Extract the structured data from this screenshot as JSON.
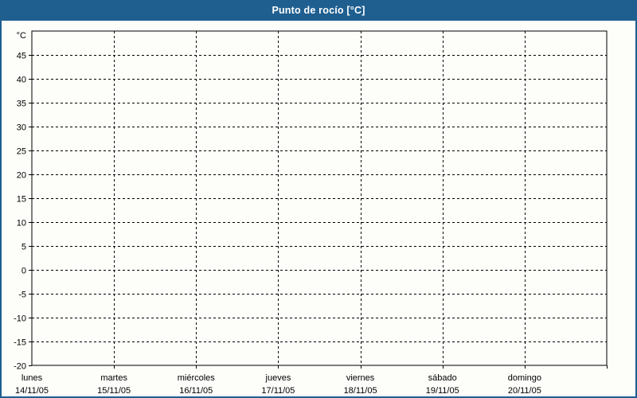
{
  "window": {
    "title": "Punto de rocío [°C]"
  },
  "colors": {
    "header_bg": "#1f5f90",
    "frame_border": "#1f5f90",
    "title_text": "#ffffff",
    "plot_bg": "#fdfdfa",
    "grid": "#000000",
    "axis": "#000000",
    "label_text": "#000000"
  },
  "chart_data": {
    "type": "line",
    "title": "Punto de rocío [°C]",
    "ylabel": "°C",
    "xlabel": "",
    "ylim": [
      -20,
      50
    ],
    "ytick_min": -20,
    "ytick_max": 45,
    "ytick_step": 5,
    "grid": "dashed",
    "legend": "none",
    "categories": [
      {
        "day": "lunes",
        "date": "14/11/05"
      },
      {
        "day": "martes",
        "date": "15/11/05"
      },
      {
        "day": "miércoles",
        "date": "16/11/05"
      },
      {
        "day": "jueves",
        "date": "17/11/05"
      },
      {
        "day": "viernes",
        "date": "18/11/05"
      },
      {
        "day": "sábado",
        "date": "19/11/05"
      },
      {
        "day": "domingo",
        "date": "20/11/05"
      }
    ],
    "series": []
  }
}
